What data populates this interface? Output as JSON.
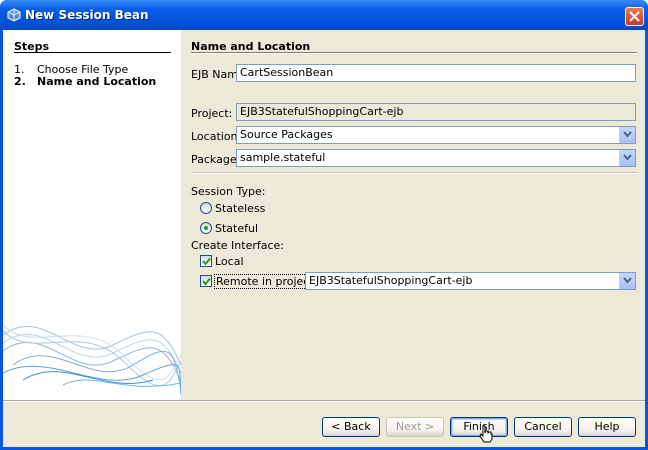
{
  "window": {
    "title": "New Session Bean"
  },
  "steps": {
    "title": "Steps",
    "items": [
      {
        "num": "1.",
        "label": "Choose File Type"
      },
      {
        "num": "2.",
        "label": "Name and Location"
      }
    ]
  },
  "panel": {
    "title": "Name and Location",
    "ejb_name_label": "EJB Name:",
    "ejb_name_value": "CartSessionBean",
    "project_label": "Project:",
    "project_value": "EJB3StatefulShoppingCart-ejb",
    "location_label": "Location:",
    "location_value": "Source Packages",
    "package_label": "Package:",
    "package_value": "sample.stateful",
    "session_type_label": "Session Type:",
    "stateless_label": "Stateless",
    "stateful_label": "Stateful",
    "session_type_selected": "Stateful",
    "create_interface_label": "Create Interface:",
    "local_label": "Local",
    "local_checked": true,
    "remote_label": "Remote in project:",
    "remote_checked": true,
    "remote_project_value": "EJB3StatefulShoppingCart-ejb"
  },
  "buttons": {
    "back": "< Back",
    "next": "Next >",
    "finish": "Finish",
    "cancel": "Cancel",
    "help": "Help"
  },
  "colors": {
    "titlebar": "#0553d8",
    "dialog_bg": "#ece9d8",
    "radio_dot": "#21a121"
  },
  "icons": {
    "title": "bean-icon",
    "close": "close-icon",
    "combo_arrow": "chevron-down-icon",
    "check": "check-icon"
  }
}
